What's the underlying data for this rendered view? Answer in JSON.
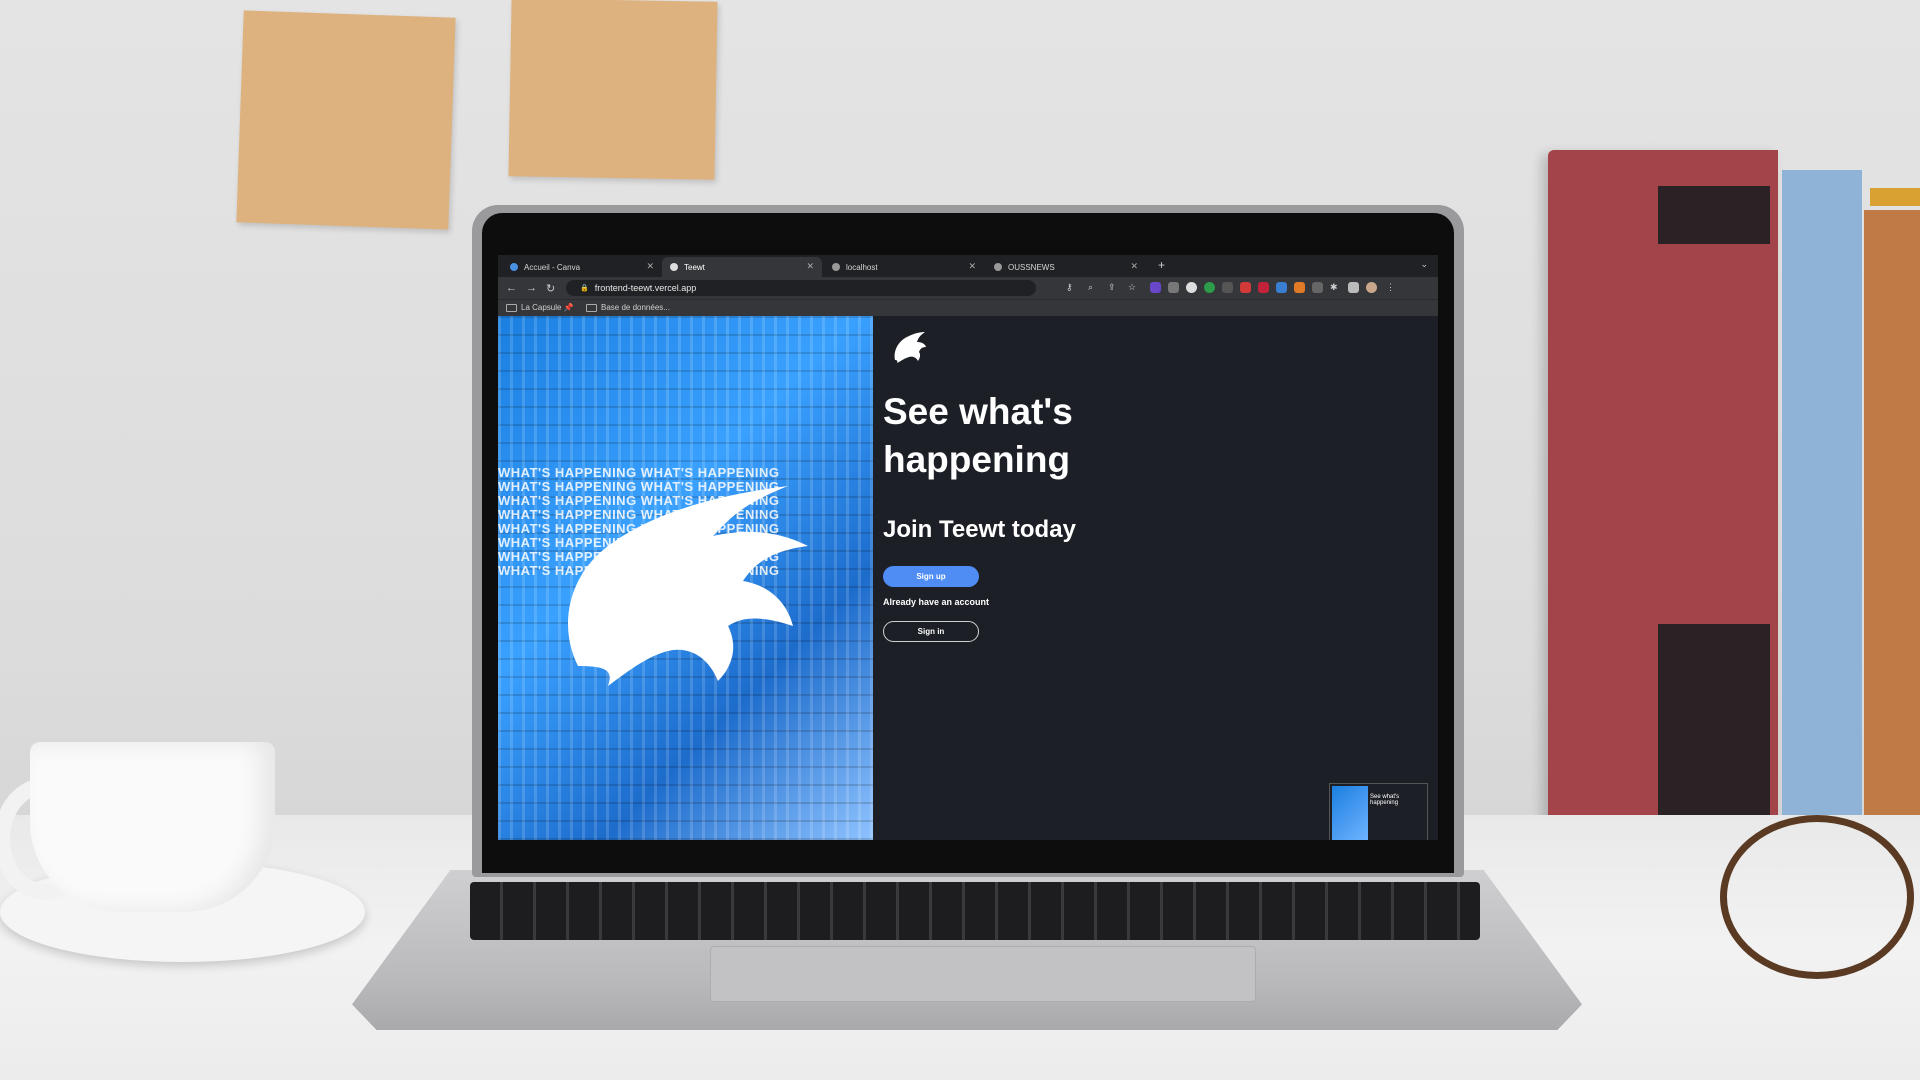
{
  "browser": {
    "tabs": [
      {
        "title": "Accueil - Canva",
        "active": false
      },
      {
        "title": "Teewt",
        "active": true
      },
      {
        "title": "localhost",
        "active": false
      },
      {
        "title": "OUSSNEWS",
        "active": false
      }
    ],
    "new_tab_glyph": "+",
    "url": "frontend-teewt.vercel.app",
    "bookmarks": [
      {
        "label": "La Capsule 📌"
      },
      {
        "label": "Base de données..."
      }
    ]
  },
  "page": {
    "headline": "See what's happening",
    "subheadline": "Join Teewt today",
    "signup_label": "Sign up",
    "already_text": "Already have an account",
    "signin_label": "Sign in",
    "hero_text": "WHAT'S HAPPENING WHAT'S HAPPENING WHAT'S HAPPENING WHAT'S HAPPENING WHAT'S HAPPENING WHAT'S HAPPENING WHAT'S HAPPENING WHAT'S HAPPENING WHAT'S HAPPENING WHAT'S HAPPENING WHAT'S HAPPENING WHAT'S HAPPENING WHAT'S HAPPENING WHAT'S HAPPENING WHAT'S HAPPENING WHAT'S HAPPENING",
    "thumbnail_title": "See what's happening"
  },
  "colors": {
    "accent": "#4f8df5",
    "page_bg": "#1c1f26",
    "hero_blue": "#1b7fe0"
  }
}
